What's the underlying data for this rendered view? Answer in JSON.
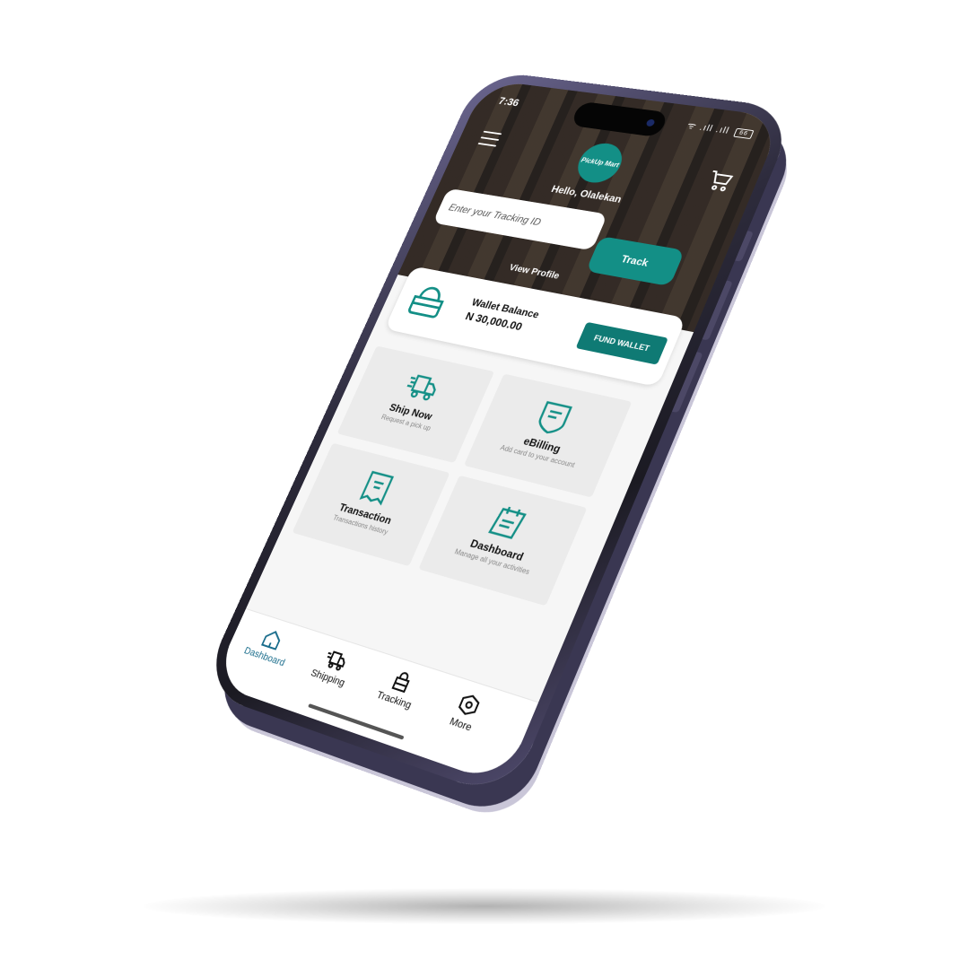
{
  "status_bar": {
    "time": "7:36",
    "icons_text": "ᯤ .ıll .ıll",
    "battery": "66"
  },
  "header": {
    "logo_text": "PickUp Mart",
    "greeting": "Hello, Olalekan",
    "tracking_placeholder": "Enter your Tracking ID",
    "track_label": "Track",
    "view_profile": "View Profile",
    "icons": {
      "menu": "hamburger-icon",
      "cart": "cart-icon"
    }
  },
  "wallet": {
    "label": "Wallet Balance",
    "amount": "N 30,000.00",
    "fund_label": "FUND WALLET",
    "icon": "wallet-bag-icon"
  },
  "tiles": [
    {
      "title": "Ship Now",
      "subtitle": "Request a pick up",
      "icon": "delivery-truck-icon"
    },
    {
      "title": "eBilling",
      "subtitle": "Add card to your account",
      "icon": "billing-badge-icon"
    },
    {
      "title": "Transaction",
      "subtitle": "Transactions history",
      "icon": "receipt-icon"
    },
    {
      "title": "Dashboard",
      "subtitle": "Manage all your activities",
      "icon": "calendar-notes-icon"
    }
  ],
  "bottom_nav": [
    {
      "label": "Dashboard",
      "icon": "home-icon",
      "active": true
    },
    {
      "label": "Shipping",
      "icon": "delivery-truck-icon",
      "active": false
    },
    {
      "label": "Tracking",
      "icon": "bag-icon",
      "active": false
    },
    {
      "label": "More",
      "icon": "hexagon-settings-icon",
      "active": false
    }
  ],
  "colors": {
    "accent": "#138f86",
    "accent_dark": "#0f7a74",
    "nav_active": "#1a6d8c",
    "tile_bg": "#ebebeb"
  }
}
